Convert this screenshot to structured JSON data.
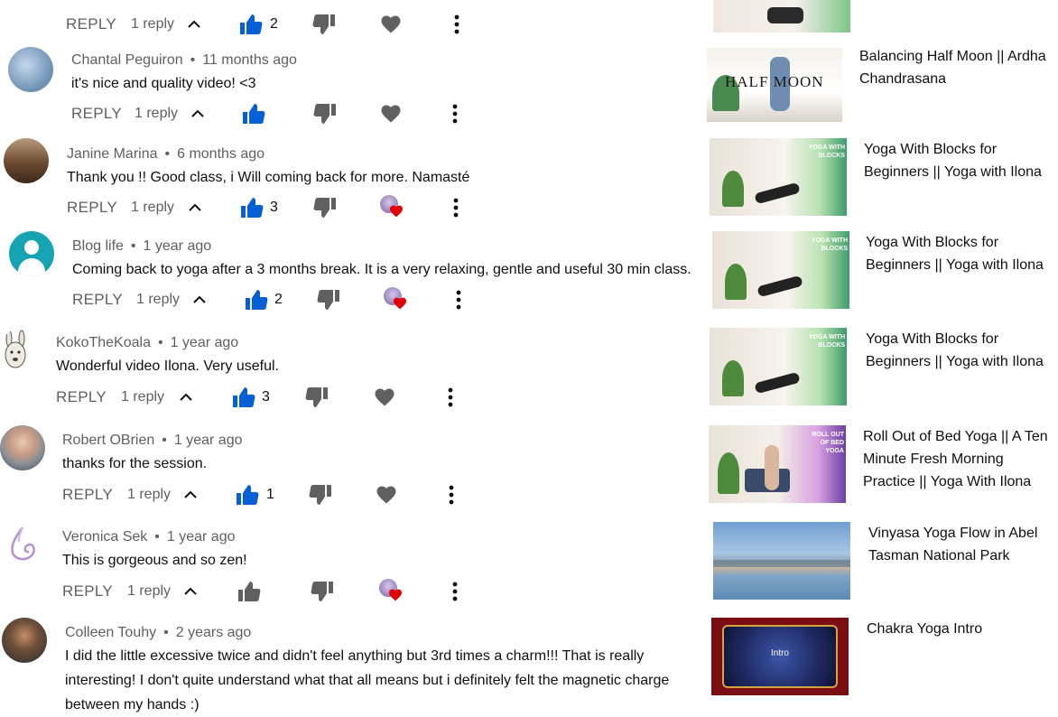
{
  "comments": [
    {
      "author": "",
      "time": "",
      "text": "",
      "reply_label": "REPLY",
      "reply_count": "1 reply",
      "likes": "2",
      "creator_heart": false
    },
    {
      "author": "Chantal Peguiron",
      "time": "11 months ago",
      "text": "it's nice and quality video! <3",
      "reply_label": "REPLY",
      "reply_count": "1 reply",
      "likes": "",
      "creator_heart": false
    },
    {
      "author": "Janine Marina",
      "time": "6 months ago",
      "text": "Thank you !! Good class, i Will coming back for more. Namasté",
      "reply_label": "REPLY",
      "reply_count": "1 reply",
      "likes": "3",
      "creator_heart": true
    },
    {
      "author": "Blog life",
      "time": "1 year ago",
      "text": "Coming back to yoga after a 3 months break. It is a very relaxing, gentle and useful 30 min class.",
      "reply_label": "REPLY",
      "reply_count": "1 reply",
      "likes": "2",
      "creator_heart": true
    },
    {
      "author": "KokoTheKoala",
      "time": "1 year ago",
      "text": "Wonderful video Ilona. Very useful.",
      "reply_label": "REPLY",
      "reply_count": "1 reply",
      "likes": "3",
      "creator_heart": false
    },
    {
      "author": "Robert OBrien",
      "time": "1 year ago",
      "text": "thanks for the session.",
      "reply_label": "REPLY",
      "reply_count": "1 reply",
      "likes": "1",
      "creator_heart": false
    },
    {
      "author": "Veronica Sek",
      "time": "1 year ago",
      "text": "This is gorgeous and so zen!",
      "reply_label": "REPLY",
      "reply_count": "1 reply",
      "likes": "",
      "creator_heart": true
    },
    {
      "author": "Colleen Touhy",
      "time": "2 years ago",
      "text_lines": [
        "I did the little excessive twice and didn't feel anything but 3rd times a charm!!! That is really",
        "interesting! I don't quite understand what that all means but i definitely felt the magnetic charge",
        "between my hands :)"
      ]
    }
  ],
  "sidebar": [
    {
      "title": "",
      "thumb_text": ""
    },
    {
      "title": "Balancing Half Moon || Ardha Chandrasana",
      "thumb_text": "HALF MOON"
    },
    {
      "title": "Yoga With Blocks for Beginners || Yoga with Ilona",
      "thumb_text": "YOGA WITH BLOCKS"
    },
    {
      "title": "Yoga With Blocks for Beginners || Yoga with Ilona",
      "thumb_text": "YOGA WITH BLOCKS"
    },
    {
      "title": "Yoga With Blocks for Beginners || Yoga with Ilona",
      "thumb_text": "YOGA WITH BLOCKS"
    },
    {
      "title": "Roll Out of Bed Yoga || A Ten Minute Fresh Morning Practice || Yoga With Ilona",
      "thumb_text": "ROLL OUT OF BED YOGA"
    },
    {
      "title": "Vinyasa Yoga Flow in Abel Tasman National Park",
      "thumb_text": ""
    },
    {
      "title": "Chakra Yoga Intro",
      "thumb_text": "Intro"
    }
  ],
  "colors": {
    "like_active": "#065fd4",
    "icon_gray": "#606060",
    "heart_red": "#e00000"
  }
}
